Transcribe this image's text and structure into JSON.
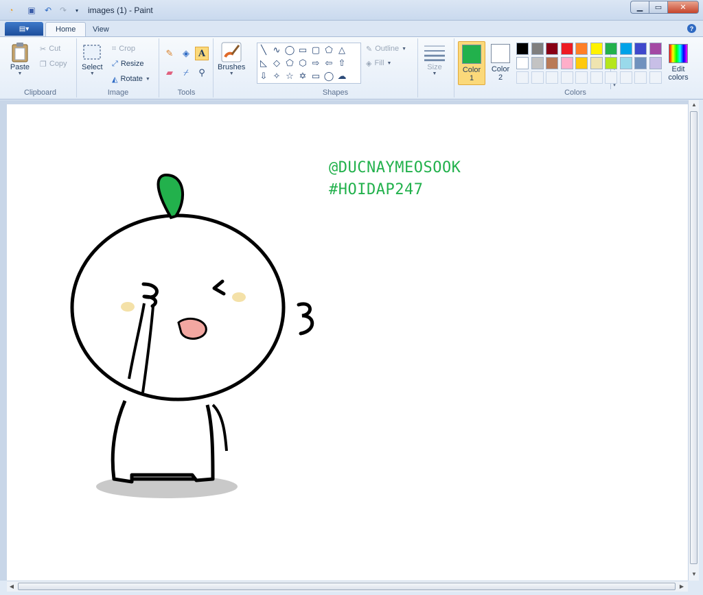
{
  "window": {
    "title": "images (1) - Paint"
  },
  "tabs": {
    "app_menu": "▤▾",
    "home": "Home",
    "view": "View",
    "help": "?"
  },
  "clipboard": {
    "paste": "Paste",
    "cut": "Cut",
    "copy": "Copy",
    "label": "Clipboard"
  },
  "image": {
    "select": "Select",
    "crop": "Crop",
    "resize": "Resize",
    "rotate": "Rotate",
    "label": "Image"
  },
  "tools": {
    "label": "Tools",
    "brushes": "Brushes"
  },
  "shapes": {
    "outline": "Outline",
    "fill": "Fill",
    "label": "Shapes"
  },
  "size": {
    "label": "Size"
  },
  "colors": {
    "label": "Colors",
    "color1_line1": "Color",
    "color1_line2": "1",
    "color2_line1": "Color",
    "color2_line2": "2",
    "edit_line1": "Edit",
    "edit_line2": "colors",
    "color1_value": "#22b14c",
    "color2_value": "#ffffff",
    "palette_row1": [
      "#000000",
      "#7f7f7f",
      "#880015",
      "#ed1c24",
      "#ff7f27",
      "#fff200",
      "#22b14c",
      "#00a2e8",
      "#3f48cc",
      "#a349a4"
    ],
    "palette_row2": [
      "#ffffff",
      "#c3c3c3",
      "#b97a57",
      "#ffaec9",
      "#ffc90e",
      "#efe4b0",
      "#b5e61d",
      "#99d9ea",
      "#7092be",
      "#c8bfe7"
    ]
  },
  "canvas": {
    "line1": "@DUCNAYMEOSOOK",
    "line2": "#HOIDAP247"
  }
}
